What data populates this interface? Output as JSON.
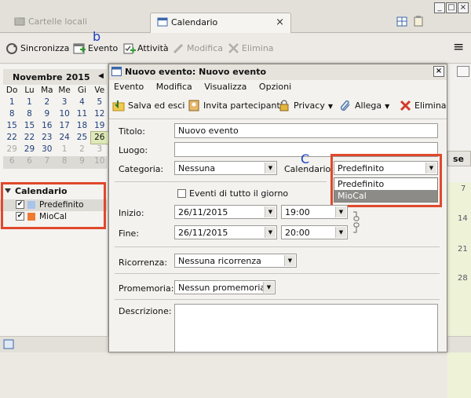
{
  "window": {
    "tabs": [
      {
        "label": "Cartelle locali",
        "icon": "folder-icon"
      },
      {
        "label": "Calendario",
        "icon": "calendar-icon"
      }
    ],
    "tab_close": "×",
    "controls": {
      "minimize": "_",
      "maximize": "□",
      "close": "×"
    }
  },
  "toolbar": {
    "sync": "Sincronizza",
    "event": "Evento",
    "task": "Attività",
    "edit": "Modifica",
    "delete": "Elimina",
    "menu_icon": "≡"
  },
  "annotations": {
    "b": "b",
    "c": "C"
  },
  "minimonth": {
    "month": "Novembre",
    "year": "2015",
    "prev": "◀",
    "weekdays": [
      "Lu",
      "Ma",
      "Me",
      "Gi",
      "Ve"
    ],
    "weeks": [
      [
        "1",
        "2",
        "3",
        "4",
        "5"
      ],
      [
        "8",
        "9",
        "10",
        "11",
        "12"
      ],
      [
        "15",
        "16",
        "17",
        "18",
        "19"
      ],
      [
        "22",
        "23",
        "24",
        "25",
        "26"
      ],
      [
        "29",
        "30",
        "1",
        "2",
        "3"
      ],
      [
        "6",
        "7",
        "8",
        "9",
        "10"
      ]
    ],
    "weekday_first": [
      "Do",
      "1",
      "8",
      "15",
      "22",
      "29",
      "6"
    ],
    "today": "26"
  },
  "calendars": {
    "title": "Calendario",
    "items": [
      {
        "name": "Predefinito",
        "color": "#a9c4e8",
        "checked": "✔"
      },
      {
        "name": "MioCal",
        "color": "#f07a32",
        "checked": "✔"
      }
    ]
  },
  "dialog": {
    "title": "Nuovo evento: Nuovo evento",
    "close": "×",
    "menu": [
      "Evento",
      "Modifica",
      "Visualizza",
      "Opzioni"
    ],
    "toolbar": {
      "save_close": "Salva ed esci",
      "invite": "Invita partecipanti",
      "privacy": "Privacy",
      "attach": "Allega",
      "delete": "Elimina"
    },
    "fields": {
      "title_label": "Titolo:",
      "title_value": "Nuovo evento",
      "location_label": "Luogo:",
      "location_value": "",
      "category_label": "Categoria:",
      "category_value": "Nessuna",
      "calendar_label": "Calendario:",
      "calendar_value": "Predefinito",
      "calendar_options": [
        "Predefinito",
        "MioCal"
      ],
      "allday_label": "Eventi di tutto il giorno",
      "start_label": "Inizio:",
      "start_date": "26/11/2015",
      "start_time": "19:00",
      "end_label": "Fine:",
      "end_date": "26/11/2015",
      "end_time": "20:00",
      "recurrence_label": "Ricorrenza:",
      "recurrence_value": "Nessuna ricorrenza",
      "reminder_label": "Promemoria:",
      "reminder_value": "Nessun promemoria",
      "description_label": "Descrizione:"
    }
  },
  "right_strip": {
    "tab": "se",
    "days": [
      "7",
      "14",
      "21",
      "28"
    ]
  },
  "colors": {
    "highlight_box": "#e0492c",
    "annotation": "#1b3fbf",
    "today_bg": "#dde9b8"
  }
}
